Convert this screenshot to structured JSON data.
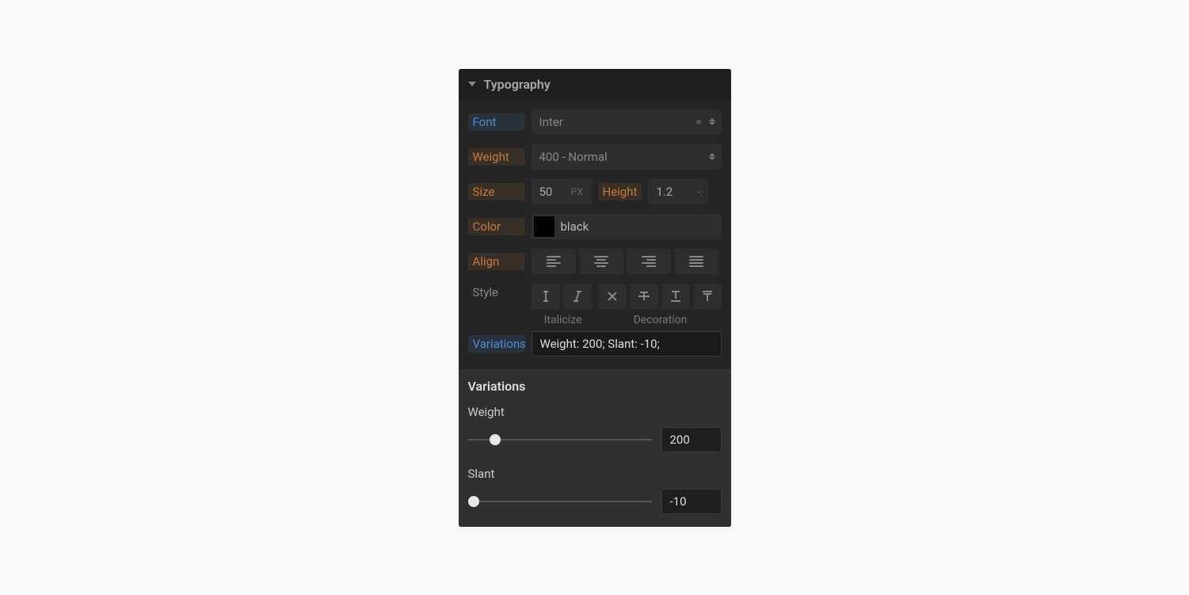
{
  "panel": {
    "title": "Typography",
    "font": {
      "label": "Font",
      "value": "Inter"
    },
    "weight": {
      "label": "Weight",
      "value": "400 - Normal"
    },
    "size": {
      "label": "Size",
      "value": "50",
      "unit": "PX"
    },
    "height": {
      "label": "Height",
      "value": "1.2",
      "unit": "-"
    },
    "color": {
      "label": "Color",
      "value": "black",
      "swatch": "#000000"
    },
    "align": {
      "label": "Align"
    },
    "style": {
      "label": "Style",
      "italicize_label": "Italicize",
      "decoration_label": "Decoration"
    },
    "variations_field": {
      "label": "Variations",
      "value": "Weight: 200; Slant: -10;"
    }
  },
  "variations_panel": {
    "title": "Variations",
    "sliders": {
      "weight": {
        "label": "Weight",
        "value": "200",
        "min": 100,
        "max": 900,
        "percent": 12
      },
      "slant": {
        "label": "Slant",
        "value": "-10",
        "min": -10,
        "max": 0,
        "percent": 0
      }
    }
  }
}
